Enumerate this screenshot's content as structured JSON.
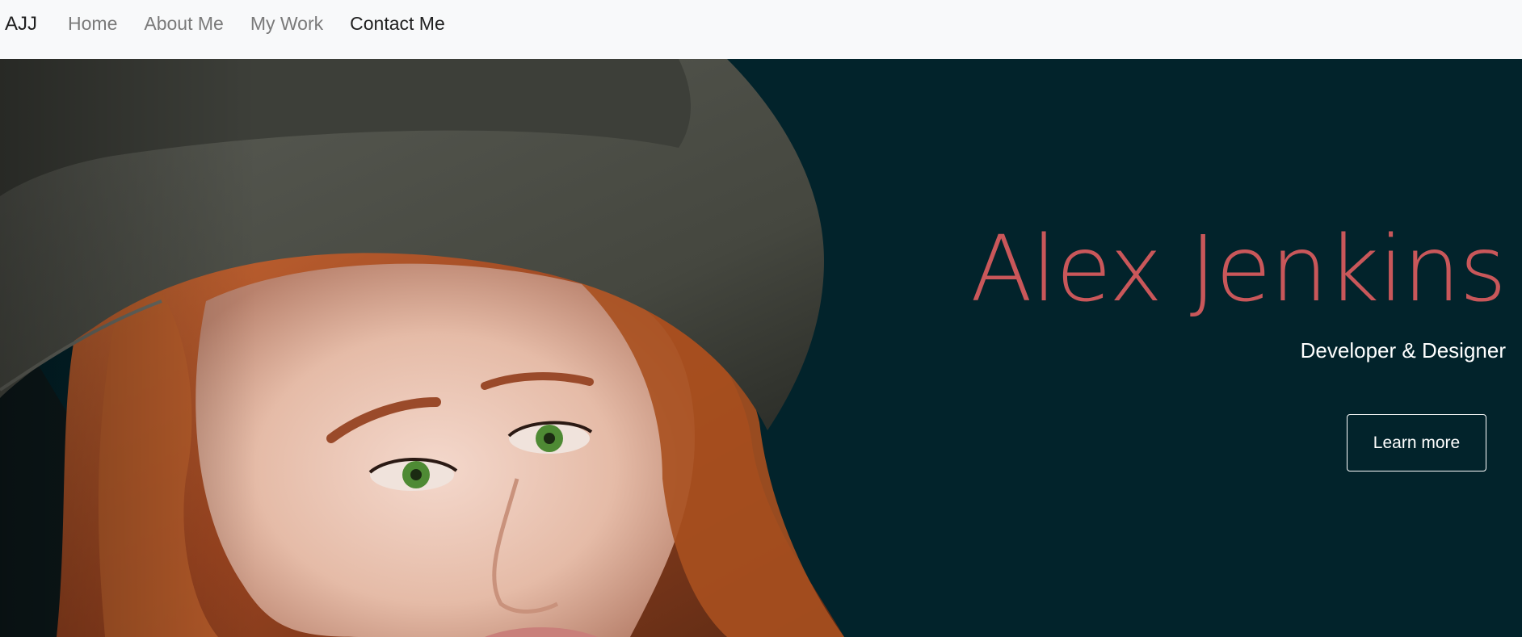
{
  "navbar": {
    "brand": "AJJ",
    "links": [
      {
        "label": "Home"
      },
      {
        "label": "About Me"
      },
      {
        "label": "My Work"
      },
      {
        "label": "Contact Me"
      }
    ]
  },
  "hero": {
    "name": "Alex Jenkins",
    "subtitle": "Developer & Designer",
    "cta_label": "Learn more"
  },
  "colors": {
    "navbar_bg": "#f8f9fa",
    "hero_bg": "#02232b",
    "name_accent": "#c9575a",
    "hair": "#b5572a",
    "hat": "#4a4c45",
    "skin": "#e8c2b0",
    "eyes": "#4e8a34"
  }
}
